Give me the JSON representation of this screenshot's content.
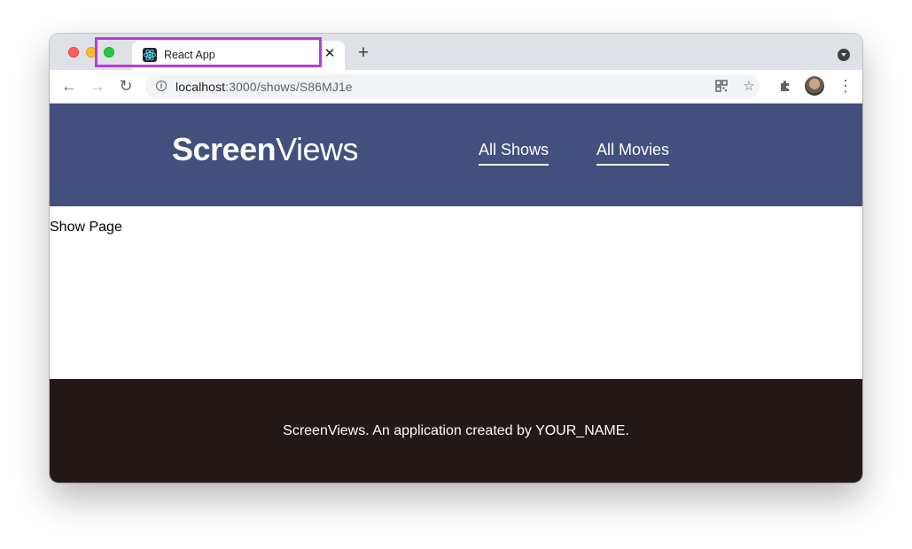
{
  "browser": {
    "tab_title": "React App",
    "tab_close": "✕",
    "new_tab": "+",
    "url_host": "localhost",
    "url_path": ":3000/shows/S86MJ1e"
  },
  "site": {
    "brand_bold": "Screen",
    "brand_light": "Views",
    "nav": [
      "All Shows",
      "All Movies"
    ],
    "page_text": "Show Page",
    "footer_text": "ScreenViews. An application created by YOUR_NAME."
  },
  "colors": {
    "header_bg": "#434f7c",
    "footer_bg": "#221816",
    "url_highlight": "#b93bdd"
  }
}
